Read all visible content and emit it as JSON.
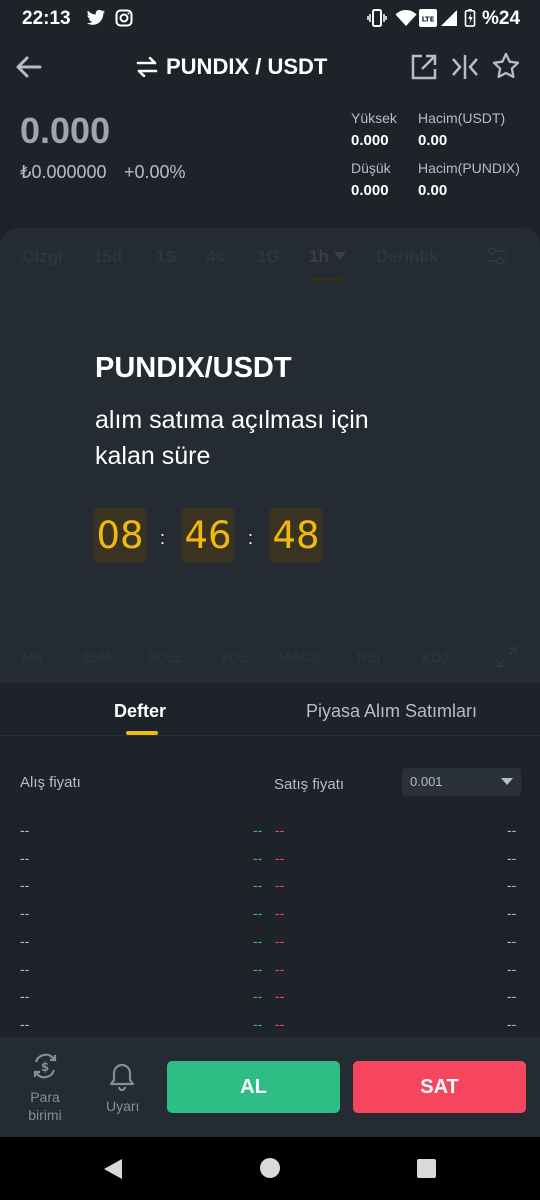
{
  "status_bar": {
    "time": "22:13",
    "battery": "%24"
  },
  "header": {
    "pair_title": "PUNDIX / USDT"
  },
  "price": {
    "main": "0.000",
    "try_value": "₺0.000000",
    "change": "+0.00%"
  },
  "stats": {
    "high_label": "Yüksek",
    "high_value": "0.000",
    "low_label": "Düşük",
    "low_value": "0.000",
    "vol_usdt_label": "Hacim(USDT)",
    "vol_usdt_value": "0.00",
    "vol_pundix_label": "Hacim(PUNDIX)",
    "vol_pundix_value": "0.00"
  },
  "timeframes": [
    "Çizgi",
    "15d",
    "1S",
    "4s",
    "1G",
    "1h",
    "Derinlik"
  ],
  "overlay": {
    "title": "PUNDIX/USDT",
    "subtitle": "alım satıma açılması için kalan süre",
    "countdown": {
      "hours": "08",
      "minutes": "46",
      "seconds": "48",
      "separator": ":"
    }
  },
  "indicators": [
    "MA",
    "EMA",
    "BOLL",
    "VOL",
    "MACD",
    "RSI",
    "KDJ"
  ],
  "tabs": {
    "book": "Defter",
    "trades": "Piyasa Alım Satımları"
  },
  "orderbook": {
    "bid_label": "Alış fiyatı",
    "ask_label": "Satış fiyatı",
    "precision": "0.001",
    "rows": [
      {
        "bid": "--",
        "bid_mark": "--",
        "ask_mark": "--",
        "ask": "--"
      },
      {
        "bid": "--",
        "bid_mark": "--",
        "ask_mark": "--",
        "ask": "--"
      },
      {
        "bid": "--",
        "bid_mark": "--",
        "ask_mark": "--",
        "ask": "--"
      },
      {
        "bid": "--",
        "bid_mark": "--",
        "ask_mark": "--",
        "ask": "--"
      },
      {
        "bid": "--",
        "bid_mark": "--",
        "ask_mark": "--",
        "ask": "--"
      },
      {
        "bid": "--",
        "bid_mark": "--",
        "ask_mark": "--",
        "ask": "--"
      },
      {
        "bid": "--",
        "bid_mark": "--",
        "ask_mark": "--",
        "ask": "--"
      },
      {
        "bid": "--",
        "bid_mark": "--",
        "ask_mark": "--",
        "ask": "--"
      }
    ]
  },
  "bottom_bar": {
    "currency_label": "Para birimi",
    "alert_label": "Uyarı",
    "buy_label": "AL",
    "sell_label": "SAT"
  },
  "colors": {
    "accent": "#f0b90b",
    "buy": "#2ebd85",
    "sell": "#f6465d",
    "background": "#1e2329"
  }
}
